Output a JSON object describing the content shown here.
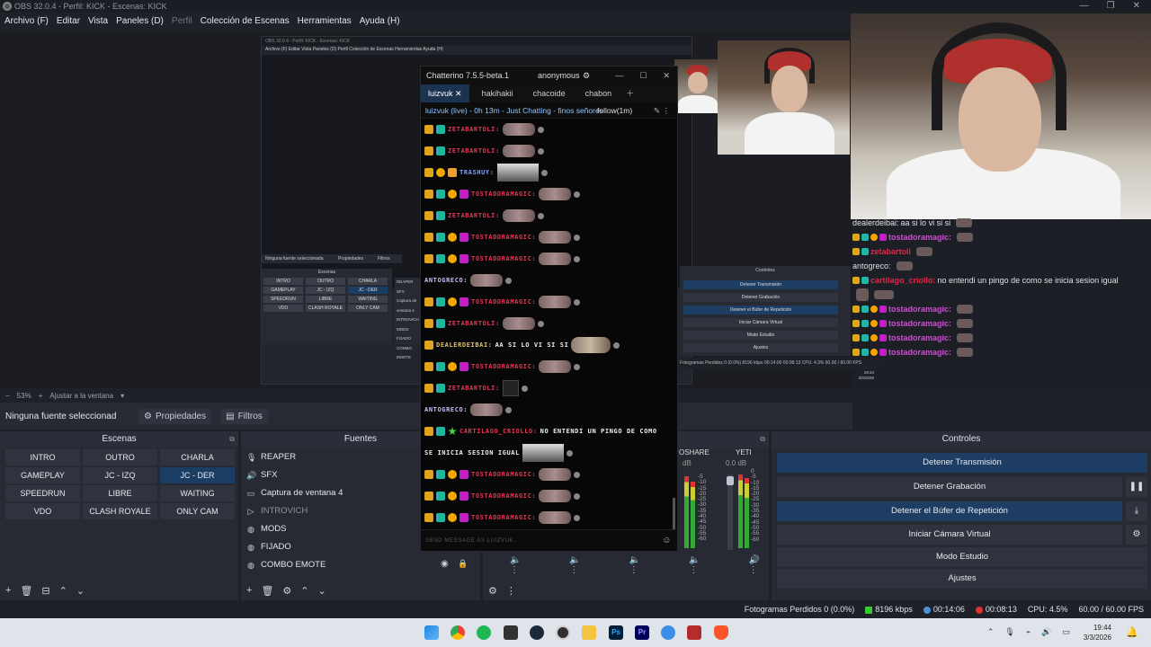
{
  "window": {
    "title": "OBS 32.0.4 - Perfil: KICK - Escenas: KICK",
    "controls": [
      "—",
      "❐",
      "✕"
    ]
  },
  "menu": [
    "Archivo (F)",
    "Editar",
    "Vista",
    "Paneles (D)",
    "Perfil",
    "Colección de Escenas",
    "Herramientas",
    "Ayuda (H)"
  ],
  "zoom": {
    "minus": "−",
    "value": "53%",
    "plus": "+",
    "fit_label": "Ajustar a la ventana"
  },
  "source_toolbar": {
    "no_source": "Ninguna fuente seleccionad",
    "properties": "Propiedades",
    "filters": "Filtros"
  },
  "scenes": {
    "title": "Escenas",
    "items": [
      "INTRO",
      "OUTRO",
      "CHARLA",
      "GAMEPLAY",
      "JC - IZQ",
      "JC - DER",
      "SPEEDRUN",
      "LIBRE",
      "WAITING",
      "VDO",
      "CLASH ROYALE",
      "ONLY CAM"
    ],
    "active": "JC - DER"
  },
  "sources": {
    "title": "Fuentes",
    "items": [
      {
        "label": "REAPER",
        "icon": "mic-icon",
        "dim": false
      },
      {
        "label": "SFX",
        "icon": "speaker-icon",
        "dim": false
      },
      {
        "label": "Captura de ventana 4",
        "icon": "window-icon",
        "dim": false
      },
      {
        "label": "INTROVICH",
        "icon": "play-icon",
        "dim": true
      },
      {
        "label": "MODS",
        "icon": "globe-icon",
        "dim": false
      },
      {
        "label": "FIJADO",
        "icon": "globe-icon",
        "dim": false
      },
      {
        "label": "COMBO EMOTE",
        "icon": "globe-icon",
        "dim": false
      }
    ]
  },
  "mixer": {
    "channels": [
      {
        "name": "OSHARE",
        "db": "dB"
      },
      {
        "name": "YETI",
        "db": "0.0 dB"
      }
    ],
    "scale": [
      "0",
      "-5",
      "-10",
      "-15",
      "-20",
      "-25",
      "-30",
      "-35",
      "-40",
      "-45",
      "-50",
      "-55",
      "-60"
    ]
  },
  "controls": {
    "title": "Controles",
    "stop_stream": "Detener Transmisión",
    "stop_record": "Detener Grabación",
    "stop_replay": "Detener el Búfer de Repetición",
    "virtual_cam": "Iniciar Cámara Virtual",
    "studio_mode": "Modo Estudio",
    "settings": "Ajustes"
  },
  "status": {
    "dropped": "Fotogramas Perdidos 0 (0.0%)",
    "bitrate": "8196 kbps",
    "stream_time": "00:14:06",
    "rec_time": "00:08:13",
    "cpu": "CPU: 4.5%",
    "fps": "60.00 / 60.00 FPS"
  },
  "chatterino": {
    "title": "Chatterino 7.5.5-beta.1",
    "account": "anonymous",
    "tabs": [
      "luizvuk",
      "hakihakii",
      "chacoide",
      "chabon"
    ],
    "active_tab": "luizvuk",
    "header": "luizvuk (live) - 0h 13m - Just Chatting - finos señores",
    "follow": "follow(1m)",
    "input_placeholder": "SEND MESSAGE AS LUIZVUK...",
    "messages": [
      {
        "name": "ZETABARTOLI",
        "color": "#e8355a",
        "badges": [
          "crown",
          "mod"
        ],
        "text": "",
        "emote": "pepe"
      },
      {
        "name": "ZETABARTOLI",
        "color": "#e8355a",
        "badges": [
          "crown",
          "mod"
        ],
        "text": "",
        "emote": "pepe"
      },
      {
        "name": "TRASHUY",
        "color": "#7aa4ff",
        "badges": [
          "crown",
          "coin",
          "box"
        ],
        "text": "",
        "emote": "pic"
      },
      {
        "name": "TOSTADORAMAGIC",
        "color": "#e8355a",
        "badges": [
          "crown",
          "mod",
          "coin",
          "sub"
        ],
        "text": "",
        "emote": "pepe"
      },
      {
        "name": "ZETABARTOLI",
        "color": "#e8355a",
        "badges": [
          "crown",
          "mod"
        ],
        "text": "",
        "emote": "pepe"
      },
      {
        "name": "TOSTADORAMAGIC",
        "color": "#e8355a",
        "badges": [
          "crown",
          "mod",
          "coin",
          "sub"
        ],
        "text": "",
        "emote": "pepe"
      },
      {
        "name": "TOSTADORAMAGIC",
        "color": "#e8355a",
        "badges": [
          "crown",
          "mod",
          "coin",
          "sub"
        ],
        "text": "",
        "emote": "pepe"
      },
      {
        "name": "ANTOGRECO",
        "color": "#c9b8ff",
        "badges": [],
        "text": "",
        "emote": "pepe"
      },
      {
        "name": "TOSTADORAMAGIC",
        "color": "#e8355a",
        "badges": [
          "crown",
          "mod",
          "coin",
          "sub"
        ],
        "text": "",
        "emote": "pepe"
      },
      {
        "name": "ZETABARTOLI",
        "color": "#e8355a",
        "badges": [
          "crown",
          "mod"
        ],
        "text": "",
        "emote": "pepe"
      },
      {
        "name": "DEALERDEIBAI",
        "color": "#e0c16a",
        "badges": [
          "crown"
        ],
        "text": "AA SI LO VI SI SI",
        "emote": "cat"
      },
      {
        "name": "TOSTADORAMAGIC",
        "color": "#e8355a",
        "badges": [
          "crown",
          "mod",
          "coin",
          "sub"
        ],
        "text": "",
        "emote": "pepe"
      },
      {
        "name": "ZETABARTOLI",
        "color": "#e8355a",
        "badges": [
          "crown",
          "mod"
        ],
        "text": "",
        "emote": "guy"
      },
      {
        "name": "ANTOGRECO",
        "color": "#c9b8ff",
        "badges": [],
        "text": "",
        "emote": "pepe"
      },
      {
        "name": "CARTILAGO_CRIOLLO",
        "color": "#e8355a",
        "badges": [
          "crown",
          "mod",
          "star"
        ],
        "text": "NO ENTENDI UN PINGO DE COMO",
        "emote": ""
      },
      {
        "name": "",
        "color": "#eee",
        "badges": [],
        "text": "SE INICIA SESION IGUAL",
        "emote": "pic"
      },
      {
        "name": "TOSTADORAMAGIC",
        "color": "#e8355a",
        "badges": [
          "crown",
          "mod",
          "coin",
          "sub"
        ],
        "text": "",
        "emote": "pepe"
      },
      {
        "name": "TOSTADORAMAGIC",
        "color": "#e8355a",
        "badges": [
          "crown",
          "mod",
          "coin",
          "sub"
        ],
        "text": "",
        "emote": "pepe"
      },
      {
        "name": "TOSTADORAMAGIC",
        "color": "#e8355a",
        "badges": [
          "crown",
          "mod",
          "coin",
          "sub"
        ],
        "text": "",
        "emote": "pepe"
      },
      {
        "name": "TOSTADORAMAGIC",
        "color": "#e8355a",
        "badges": [
          "crown",
          "mod",
          "coin",
          "sub"
        ],
        "text": "",
        "emote": "pepe"
      }
    ]
  },
  "overlay_chat": [
    {
      "name": "dealerdeibai:",
      "text": "aa si lo vi si si",
      "color": "#e0e0e0"
    },
    {
      "name": "tostadoramagic:",
      "text": "",
      "color": "#d04dd3"
    },
    {
      "name": "zetabartoli",
      "text": "",
      "color": "#e0284b"
    },
    {
      "name": "antogreco:",
      "text": "",
      "color": "#e0e0e0"
    },
    {
      "name": "cartilago_criollo:",
      "text": "no entendi un pingo de como se inicia sesion igual",
      "color": "#e0284b"
    },
    {
      "name": "",
      "text": "",
      "color": "#e0e0e0"
    },
    {
      "name": "tostadoramagic:",
      "text": "",
      "color": "#d04dd3"
    },
    {
      "name": "tostadoramagic:",
      "text": "",
      "color": "#d04dd3"
    },
    {
      "name": "tostadoramagic:",
      "text": "",
      "color": "#d04dd3"
    },
    {
      "name": "tostadoramagic:",
      "text": "",
      "color": "#d04dd3"
    }
  ],
  "nested_obs": {
    "title": "OBS 32.0.4 - Perfil: KICK - Escenas: KICK",
    "menu": "Archivo (F)   Editar   Vista   Paneles (D)   Perfil   Colección de Escenas   Herramientas   Ayuda (H)",
    "no_source": "Ninguna fuente seleccionada",
    "properties": "Propiedades",
    "filters": "Filtros",
    "scenes_title": "Escenas",
    "scene_items": [
      "INTRO",
      "OUTRO",
      "CHARLA",
      "GAMEPLAY",
      "JC - IZQ",
      "JC - DER",
      "SPEEDRUN",
      "LIBRE",
      "WAITING",
      "VDO",
      "CLASH ROYALE",
      "ONLY CAM"
    ],
    "source_items": [
      "REAPER",
      "SFX",
      "Captura de ventana 4",
      "INTROVICH",
      "MODS",
      "FIJADO",
      "COMBO EMOTE"
    ],
    "controls_title": "Controles",
    "control_items": [
      "Detener Transmisión",
      "Detener Grabación",
      "Detener el Búfer de Repetición",
      "Iniciar Cámara Virtual",
      "Modo Estudio",
      "Ajustes"
    ],
    "status": "Fotogramas Perdidos 0 (0.0%)   8196 kbps   00:14:00   00:08:13   CPU: 4.3%   60.00 / 60.00 FPS",
    "clock_time": "19:44",
    "clock_date": "3/3/2026"
  },
  "taskbar": {
    "time": "19:44",
    "date": "3/3/2026",
    "icons": [
      "windows-icon",
      "chrome-icon",
      "spotify-icon",
      "xbox-icon",
      "steam-icon",
      "obs-icon",
      "folder-icon",
      "photoshop-icon",
      "premiere-icon",
      "chatterino-icon",
      "voicemeeter-icon",
      "brave-icon"
    ]
  }
}
